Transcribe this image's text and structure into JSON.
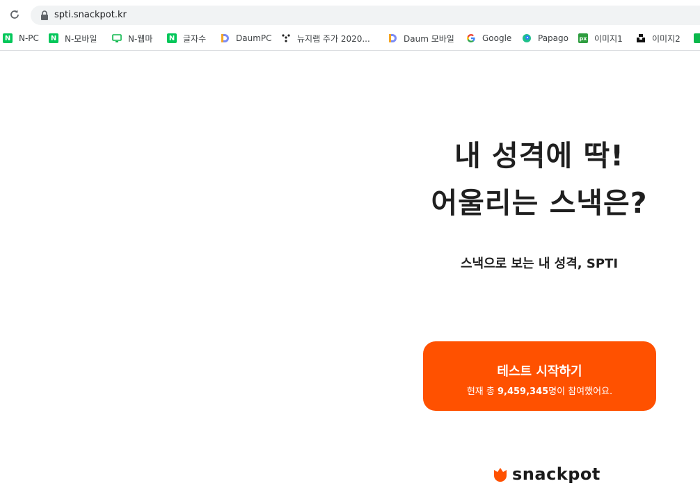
{
  "browser": {
    "url": "spti.snackpot.kr",
    "bookmarks": [
      {
        "label": "N-PC",
        "icon": "naver-icon"
      },
      {
        "label": "N-모바일",
        "icon": "naver-icon"
      },
      {
        "label": "N-웹마",
        "icon": "monitor-icon"
      },
      {
        "label": "글자수",
        "icon": "naver-icon"
      },
      {
        "label": "DaumPC",
        "icon": "daum-icon"
      },
      {
        "label": "뉴지랩 주가 2020...",
        "icon": "dots-icon"
      },
      {
        "label": "Daum 모바일",
        "icon": "daum-icon"
      },
      {
        "label": "Google",
        "icon": "google-icon"
      },
      {
        "label": "Papago",
        "icon": "papago-icon"
      },
      {
        "label": "이미지1",
        "icon": "px-icon",
        "icon_text": "px"
      },
      {
        "label": "이미지2",
        "icon": "unsplash-icon"
      }
    ]
  },
  "page": {
    "title_line1": "내 성격에 딱!",
    "title_line2": "어울리는 스낵은?",
    "subtitle": "스낵으로 보는 내 성격, SPTI",
    "cta": {
      "label": "테스트 시작하기",
      "count_prefix": "현재 총 ",
      "count_value": "9,459,345",
      "count_suffix": "명이 참여했어요."
    },
    "logo_text": "snackpot"
  },
  "colors": {
    "accent": "#ff5100",
    "naver_green": "#03c75a"
  }
}
